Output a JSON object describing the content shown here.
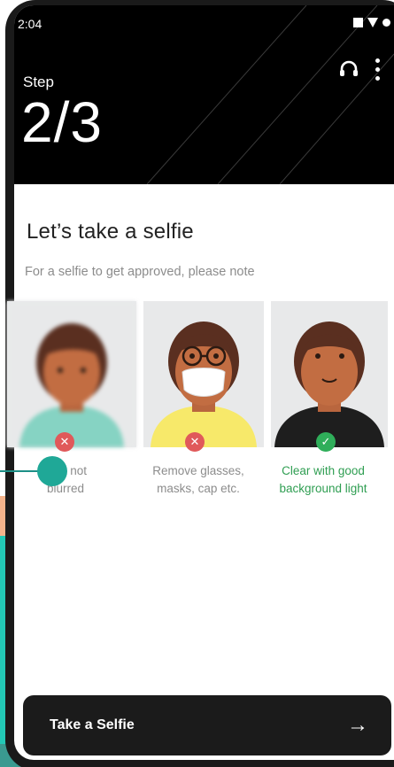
{
  "status_bar": {
    "time": "2:04"
  },
  "header": {
    "step_label": "Step",
    "step_value": "2/3"
  },
  "icons": {
    "support": "headset-icon",
    "menu": "more-vert-icon",
    "reject": "close-icon",
    "accept": "check-icon",
    "arrow": "arrow-right-icon"
  },
  "content": {
    "title": "Let’s take a selfie",
    "subtitle": "For a selfie to get approved, please note"
  },
  "guidelines": [
    {
      "caption_line1": "re is not",
      "caption_line2": "blurred",
      "status": "reject"
    },
    {
      "caption_line1": "Remove glasses,",
      "caption_line2": "masks, cap etc.",
      "status": "reject"
    },
    {
      "caption_line1": "Clear with good",
      "caption_line2": "background light",
      "status": "accept"
    }
  ],
  "cta": {
    "label": "Take a Selfie",
    "arrow": "→"
  },
  "colors": {
    "header": "#000000",
    "reject": "#e0595a",
    "accept": "#2fae5a",
    "accept_text": "#2f9e52",
    "cta": "#1b1b1b",
    "teal": "#23c9b6",
    "orange": "#f5b48c"
  }
}
